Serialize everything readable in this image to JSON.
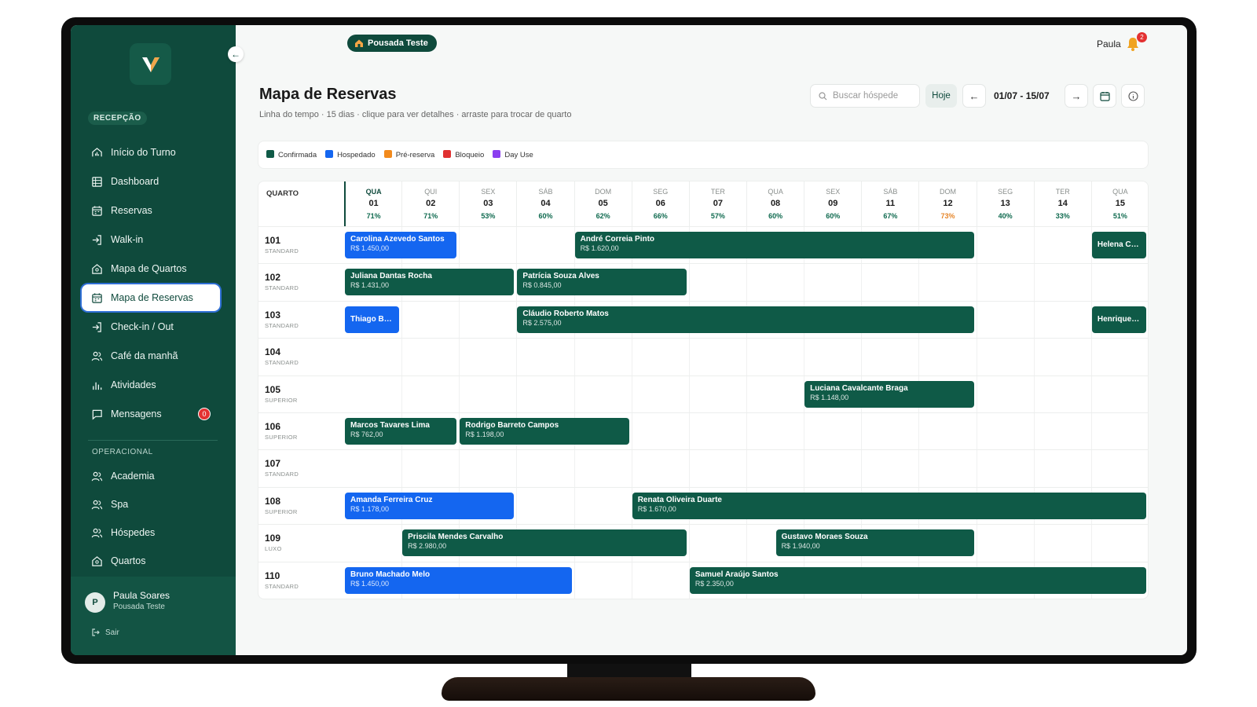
{
  "sidebar": {
    "section_reception": "RECEPÇÃO",
    "section_operational": "OPERACIONAL",
    "items_reception": [
      {
        "label": "Início do Turno",
        "icon": "home-chart-icon"
      },
      {
        "label": "Dashboard",
        "icon": "grid-icon"
      },
      {
        "label": "Reservas",
        "icon": "calendar-icon"
      },
      {
        "label": "Walk-in",
        "icon": "enter-icon"
      },
      {
        "label": "Mapa de Quartos",
        "icon": "home-icon"
      },
      {
        "label": "Mapa de Reservas",
        "icon": "calendar-icon",
        "active": true
      },
      {
        "label": "Check-in / Out",
        "icon": "enter-icon"
      },
      {
        "label": "Café da manhã",
        "icon": "users-icon"
      },
      {
        "label": "Atividades",
        "icon": "bar-chart-icon"
      },
      {
        "label": "Mensagens",
        "icon": "message-icon",
        "badge": "0"
      }
    ],
    "items_operational": [
      {
        "label": "Academia",
        "icon": "users-icon"
      },
      {
        "label": "Spa",
        "icon": "users-icon"
      },
      {
        "label": "Hóspedes",
        "icon": "users-icon"
      },
      {
        "label": "Quartos",
        "icon": "home-icon"
      }
    ],
    "user": {
      "initial": "P",
      "name": "Paula Soares",
      "property": "Pousada Teste",
      "logout": "Sair"
    }
  },
  "header": {
    "property": "Pousada Teste",
    "user": "Paula",
    "notifications": "2",
    "title": "Mapa de Reservas",
    "subtitle": "Linha do tempo · 15 dias · clique para ver detalhes · arraste para trocar de quarto",
    "search_placeholder": "Buscar hóspede",
    "today_label": "Hoje",
    "range": "01/07 - 15/07"
  },
  "legend": [
    {
      "label": "Confirmada",
      "color": "#0f5a47"
    },
    {
      "label": "Hospedado",
      "color": "#1466f0"
    },
    {
      "label": "Pré-reserva",
      "color": "#f28a1c"
    },
    {
      "label": "Bloqueio",
      "color": "#e03131"
    },
    {
      "label": "Day Use",
      "color": "#8b3ff0"
    }
  ],
  "colors": {
    "confirmada": "#0f5a47",
    "hospedado": "#1466f0"
  },
  "grid": {
    "room_header": "QUARTO",
    "days": [
      {
        "wd": "QUA",
        "num": "01",
        "occ": "71%"
      },
      {
        "wd": "QUI",
        "num": "02",
        "occ": "71%"
      },
      {
        "wd": "SEX",
        "num": "03",
        "occ": "53%"
      },
      {
        "wd": "SÁB",
        "num": "04",
        "occ": "60%"
      },
      {
        "wd": "DOM",
        "num": "05",
        "occ": "62%"
      },
      {
        "wd": "SEG",
        "num": "06",
        "occ": "66%"
      },
      {
        "wd": "TER",
        "num": "07",
        "occ": "57%"
      },
      {
        "wd": "QUA",
        "num": "08",
        "occ": "60%"
      },
      {
        "wd": "SEX",
        "num": "09",
        "occ": "60%"
      },
      {
        "wd": "SÁB",
        "num": "11",
        "occ": "67%"
      },
      {
        "wd": "DOM",
        "num": "12",
        "occ": "73%",
        "highlight": true
      },
      {
        "wd": "SEG",
        "num": "13",
        "occ": "40%"
      },
      {
        "wd": "TER",
        "num": "14",
        "occ": "33%"
      },
      {
        "wd": "QUA",
        "num": "15",
        "occ": "51%"
      }
    ],
    "rooms": [
      {
        "num": "101",
        "type": "STANDARD"
      },
      {
        "num": "102",
        "type": "STANDARD"
      },
      {
        "num": "103",
        "type": "STANDARD"
      },
      {
        "num": "104",
        "type": "STANDARD"
      },
      {
        "num": "105",
        "type": "SUPERIOR"
      },
      {
        "num": "106",
        "type": "SUPERIOR"
      },
      {
        "num": "107",
        "type": "STANDARD"
      },
      {
        "num": "108",
        "type": "SUPERIOR"
      },
      {
        "num": "109",
        "type": "LUXO"
      },
      {
        "num": "110",
        "type": "STANDARD"
      }
    ],
    "bookings": [
      {
        "room": 0,
        "start": 0,
        "end": 2,
        "status": "hospedado",
        "name": "Carolina Azevedo Santos",
        "value": "R$ 1.450,00"
      },
      {
        "room": 0,
        "start": 4,
        "end": 11,
        "status": "confirmada",
        "name": "André Correia Pinto",
        "value": "R$ 1.620,00"
      },
      {
        "room": 0,
        "start": 13,
        "end": 14,
        "status": "confirmada",
        "name": "Helena Castr...",
        "value": ""
      },
      {
        "room": 1,
        "start": 0,
        "end": 3,
        "status": "confirmada",
        "name": "Juliana Dantas Rocha",
        "value": "R$ 1.431,00"
      },
      {
        "room": 1,
        "start": 3,
        "end": 6,
        "status": "confirmada",
        "name": "Patrícia Souza Alves",
        "value": "R$ 0.845,00"
      },
      {
        "room": 2,
        "start": 0,
        "end": 1,
        "status": "hospedado",
        "name": "Thiago Barro...",
        "value": ""
      },
      {
        "room": 2,
        "start": 3,
        "end": 11,
        "status": "confirmada",
        "name": "Cláudio Roberto Matos",
        "value": "R$ 2.575,00"
      },
      {
        "room": 2,
        "start": 13,
        "end": 14,
        "status": "confirmada",
        "name": "Henrique Al...",
        "value": ""
      },
      {
        "room": 4,
        "start": 8,
        "end": 11,
        "status": "confirmada",
        "name": "Luciana Cavalcante Braga",
        "value": "R$ 1.148,00"
      },
      {
        "room": 5,
        "start": 0,
        "end": 2,
        "status": "confirmada",
        "name": "Marcos Tavares Lima",
        "value": "R$ 762,00"
      },
      {
        "room": 5,
        "start": 2,
        "end": 5,
        "status": "confirmada",
        "name": "Rodrigo Barreto Campos",
        "value": "R$ 1.198,00"
      },
      {
        "room": 7,
        "start": 0,
        "end": 3,
        "status": "hospedado",
        "name": "Amanda Ferreira Cruz",
        "value": "R$ 1.178,00"
      },
      {
        "room": 7,
        "start": 5,
        "end": 14,
        "status": "confirmada",
        "name": "Renata Oliveira Duarte",
        "value": "R$ 1.670,00"
      },
      {
        "room": 8,
        "start": 1,
        "end": 6,
        "status": "confirmada",
        "name": "Priscila Mendes Carvalho",
        "value": "R$ 2.980,00"
      },
      {
        "room": 8,
        "start": 7.5,
        "end": 11,
        "status": "confirmada",
        "name": "Gustavo Moraes Souza",
        "value": "R$ 1.940,00"
      },
      {
        "room": 9,
        "start": 0,
        "end": 4,
        "status": "hospedado",
        "name": "Bruno Machado Melo",
        "value": "R$ 1.450,00"
      },
      {
        "room": 9,
        "start": 6,
        "end": 14,
        "status": "confirmada",
        "name": "Samuel Araújo Santos",
        "value": "R$ 2.350,00"
      }
    ]
  }
}
